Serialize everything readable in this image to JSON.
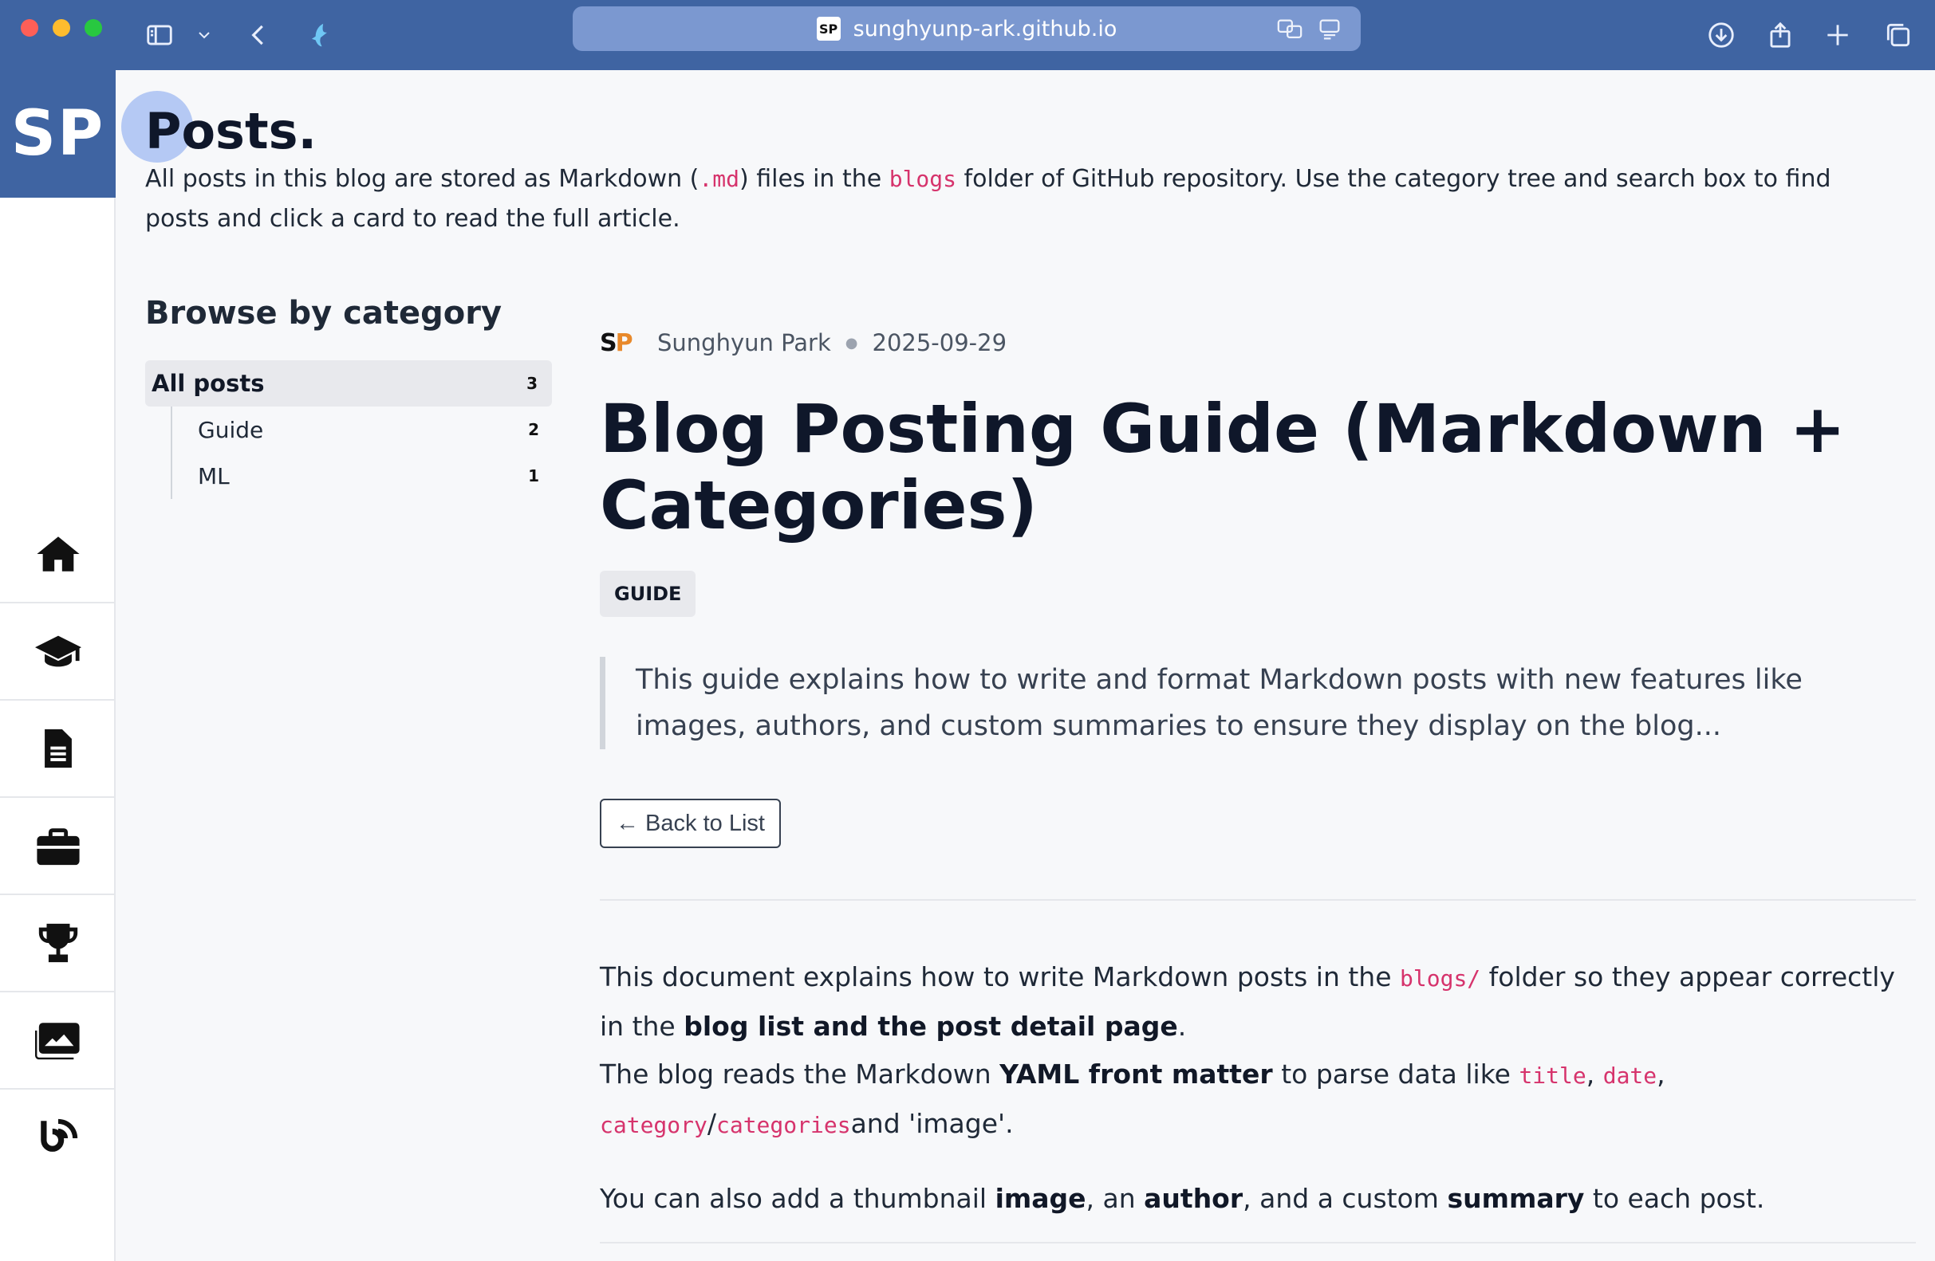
{
  "browser": {
    "url": "sunghyunp-ark.github.io",
    "favicon_text": "SP"
  },
  "site": {
    "logo_text": "SP",
    "nav": [
      {
        "icon": "home-icon"
      },
      {
        "icon": "graduation-cap-icon"
      },
      {
        "icon": "document-icon"
      },
      {
        "icon": "briefcase-icon"
      },
      {
        "icon": "trophy-icon"
      },
      {
        "icon": "images-icon"
      },
      {
        "icon": "blog-icon"
      }
    ]
  },
  "page": {
    "title": "Posts.",
    "intro_1": "All posts in this blog are stored as Markdown (",
    "intro_code_1": ".md",
    "intro_2": ") files in the ",
    "intro_code_2": "blogs",
    "intro_3": " folder of GitHub repository. Use the category tree and search box to find posts and click a card to read the full article."
  },
  "categories": {
    "title": "Browse by category",
    "all": {
      "label": "All posts",
      "count": "3"
    },
    "items": [
      {
        "label": "Guide",
        "count": "2"
      },
      {
        "label": "ML",
        "count": "1"
      }
    ]
  },
  "post": {
    "author": "Sunghyun Park",
    "date": "2025-09-29",
    "title": "Blog Posting Guide (Markdown + Categories)",
    "tag": "GUIDE",
    "summary": "This guide explains how to write and format Markdown posts with new features like images, authors, and custom summaries to ensure they display on the blog...",
    "back_label": "← Back to List",
    "p1_a": "This document explains how to write Markdown posts in the ",
    "p1_code": "blogs/",
    "p1_b": " folder so they appear correctly in the ",
    "p1_bold": "blog list and the post detail page",
    "p1_c": ".",
    "p2_a": "The blog reads the Markdown ",
    "p2_bold": "YAML front matter",
    "p2_b": " to parse data like ",
    "p2_code_1": "title",
    "p2_sep_1": ", ",
    "p2_code_2": "date",
    "p2_sep_2": ", ",
    "p2_code_3": "category",
    "p2_sep_3": "/",
    "p2_code_4": "categories",
    "p2_c": "and 'image'.",
    "p3_a": "You can also add a thumbnail ",
    "p3_bold_1": "image",
    "p3_b": ", an ",
    "p3_bold_2": "author",
    "p3_c": ", and a custom ",
    "p3_bold_3": "summary",
    "p3_d": " to each post."
  }
}
